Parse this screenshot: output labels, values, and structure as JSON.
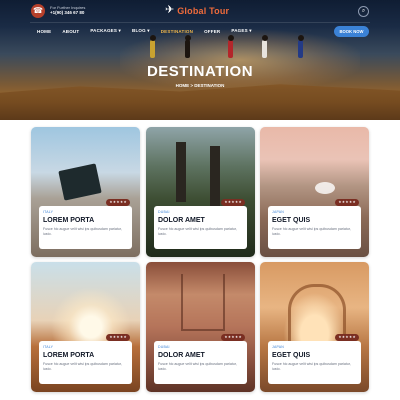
{
  "header": {
    "contact_label": "For Further Inquires",
    "contact_phone": "+1(90) 346 67 80",
    "brand": "Global Tour",
    "book_label": "BOOK NOW"
  },
  "nav": {
    "items": [
      {
        "label": "HOME",
        "active": false
      },
      {
        "label": "ABOUT",
        "active": false
      },
      {
        "label": "PACKAGES ▾",
        "active": false
      },
      {
        "label": "BLOG ▾",
        "active": false
      },
      {
        "label": "DESTINATION",
        "active": true
      },
      {
        "label": "OFFER",
        "active": false
      },
      {
        "label": "PAGES ▾",
        "active": false
      }
    ]
  },
  "hero": {
    "title": "DESTINATION",
    "breadcrumb": "HOME > DESTINATION"
  },
  "cards": [
    {
      "category": "ITALY",
      "title": "LOREM PORTA",
      "desc": "Fusce hic augue velit wisi ips quibusdam pariatur, iusto.",
      "rating": "★★★★★"
    },
    {
      "category": "DUBAI",
      "title": "DOLOR AMET",
      "desc": "Fusce hic augue velit wisi ips quibusdam pariatur, iusto.",
      "rating": "★★★★★"
    },
    {
      "category": "JAPAN",
      "title": "EGET QUIS",
      "desc": "Fusce hic augue velit wisi ips quibusdam pariatur, iusto.",
      "rating": "★★★★★"
    },
    {
      "category": "ITALY",
      "title": "LOREM PORTA",
      "desc": "Fusce hic augue velit wisi ips quibusdam pariatur, iusto.",
      "rating": "★★★★★"
    },
    {
      "category": "DUBAI",
      "title": "DOLOR AMET",
      "desc": "Fusce hic augue velit wisi ips quibusdam pariatur, iusto.",
      "rating": "★★★★★"
    },
    {
      "category": "JAPAN",
      "title": "EGET QUIS",
      "desc": "Fusce hic augue velit wisi ips quibusdam pariatur, iusto.",
      "rating": "★★★★★"
    }
  ],
  "colors": {
    "brand_accent": "#ef6b3b",
    "primary_button": "#3b82d6",
    "nav_active": "#f2b84b",
    "rating_badge": "#7a2e22"
  },
  "icons": {
    "phone": "phone-icon",
    "logo": "plane-icon",
    "search": "search-icon"
  }
}
